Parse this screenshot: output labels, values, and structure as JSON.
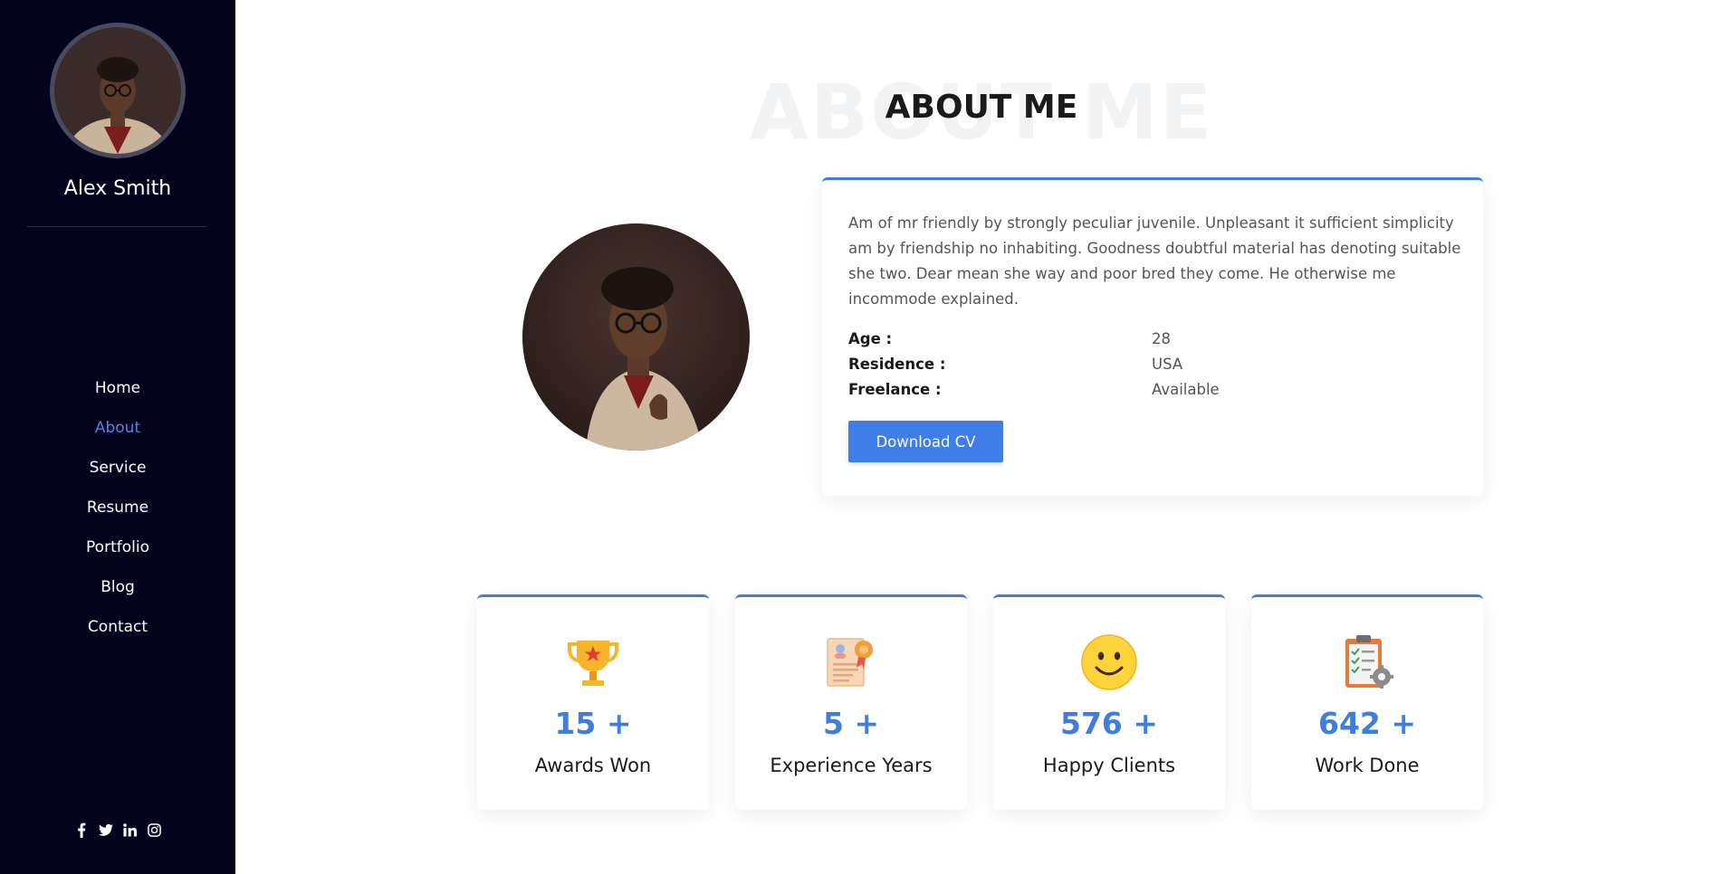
{
  "sidebar": {
    "name": "Alex Smith",
    "nav": [
      {
        "label": "Home",
        "active": false
      },
      {
        "label": "About",
        "active": true
      },
      {
        "label": "Service",
        "active": false
      },
      {
        "label": "Resume",
        "active": false
      },
      {
        "label": "Portfolio",
        "active": false
      },
      {
        "label": "Blog",
        "active": false
      },
      {
        "label": "Contact",
        "active": false
      }
    ],
    "social": [
      "facebook-icon",
      "twitter-icon",
      "linkedin-icon",
      "instagram-icon"
    ]
  },
  "about": {
    "bg_title": "ABOUT ME",
    "title": "ABOUT ME",
    "description": "Am of mr friendly by strongly peculiar juvenile. Unpleasant it sufficient simplicity am by friendship no inhabiting. Goodness doubtful material has denoting suitable she two. Dear mean she way and poor bred they come. He otherwise me incommode explained.",
    "info": [
      {
        "label": "Age :",
        "value": "28"
      },
      {
        "label": "Residence :",
        "value": "USA"
      },
      {
        "label": "Freelance :",
        "value": "Available"
      }
    ],
    "button": "Download CV"
  },
  "stats": [
    {
      "icon": "trophy-icon",
      "number": "15 +",
      "label": "Awards Won"
    },
    {
      "icon": "certificate-icon",
      "number": "5 +",
      "label": "Experience Years"
    },
    {
      "icon": "smiley-icon",
      "number": "576 +",
      "label": "Happy Clients"
    },
    {
      "icon": "clipboard-icon",
      "number": "642 +",
      "label": "Work Done"
    }
  ],
  "colors": {
    "accent": "#3f7de0",
    "sidebar_bg": "#03031e",
    "active_nav": "#4f83e8"
  }
}
